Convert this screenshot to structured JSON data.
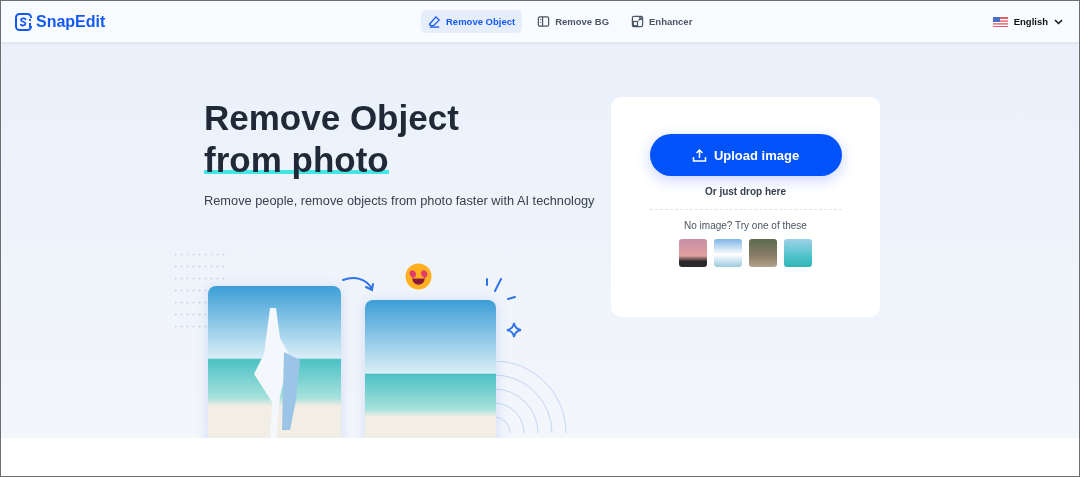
{
  "header": {
    "logo": "SnapEdit",
    "tabs": [
      {
        "label": "Remove Object",
        "kind": "eraser",
        "selected": true
      },
      {
        "label": "Remove BG",
        "kind": "layers",
        "selected": false
      },
      {
        "label": "Enhancer",
        "kind": "enlarge",
        "selected": false
      }
    ],
    "language": "English"
  },
  "hero": {
    "title": "Remove Object",
    "title_highlight": "from photo",
    "subtitle": "Remove people, remove objects from photo faster with AI technology"
  },
  "upload_card": {
    "button": "Upload image",
    "drop_hint": "Or just drop here",
    "samples_label": "No image? Try one of these"
  }
}
